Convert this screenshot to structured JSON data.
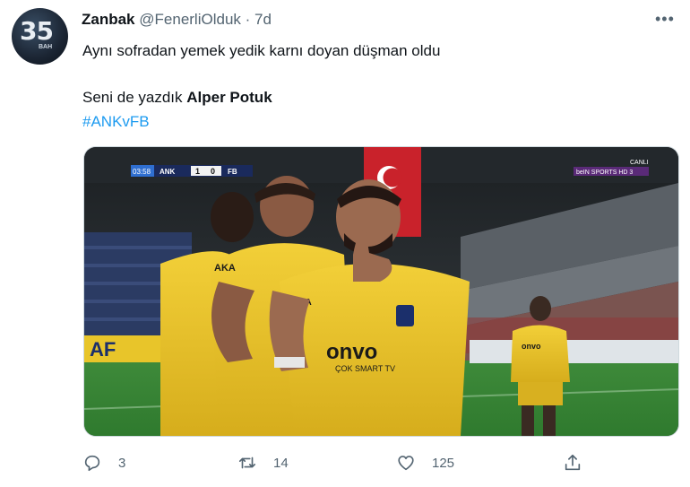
{
  "tweet": {
    "avatar_text": "35",
    "avatar_sub": "BAH",
    "display_name": "Zanbak",
    "handle": "@FenerliOlduk",
    "separator": " · ",
    "time": "7d",
    "more_label": "•••",
    "line1": "Aynı sofradan yemek yedik karnı doyan düşman oldu",
    "line2_prefix": "Seni de yazdık ",
    "line2_bold": "Alper Potuk",
    "hashtag": "#ANKvFB"
  },
  "media": {
    "scoreboard": {
      "time": "03:58",
      "home": "ANK",
      "home_score": "1",
      "away_score": "0",
      "away": "FB"
    },
    "channel_status": "CANLI",
    "channel": "beIN SPORTS HD 3",
    "ad_board": "AF",
    "sponsor": "onvo",
    "sponsor_sub": "ÇOK SMART TV",
    "kit_sponsor": "AKA"
  },
  "actions": {
    "replies": "3",
    "retweets": "14",
    "likes": "125"
  },
  "colors": {
    "accent": "#1d9bf0",
    "secondary_text": "#536471",
    "jersey": "#e9c32a"
  }
}
